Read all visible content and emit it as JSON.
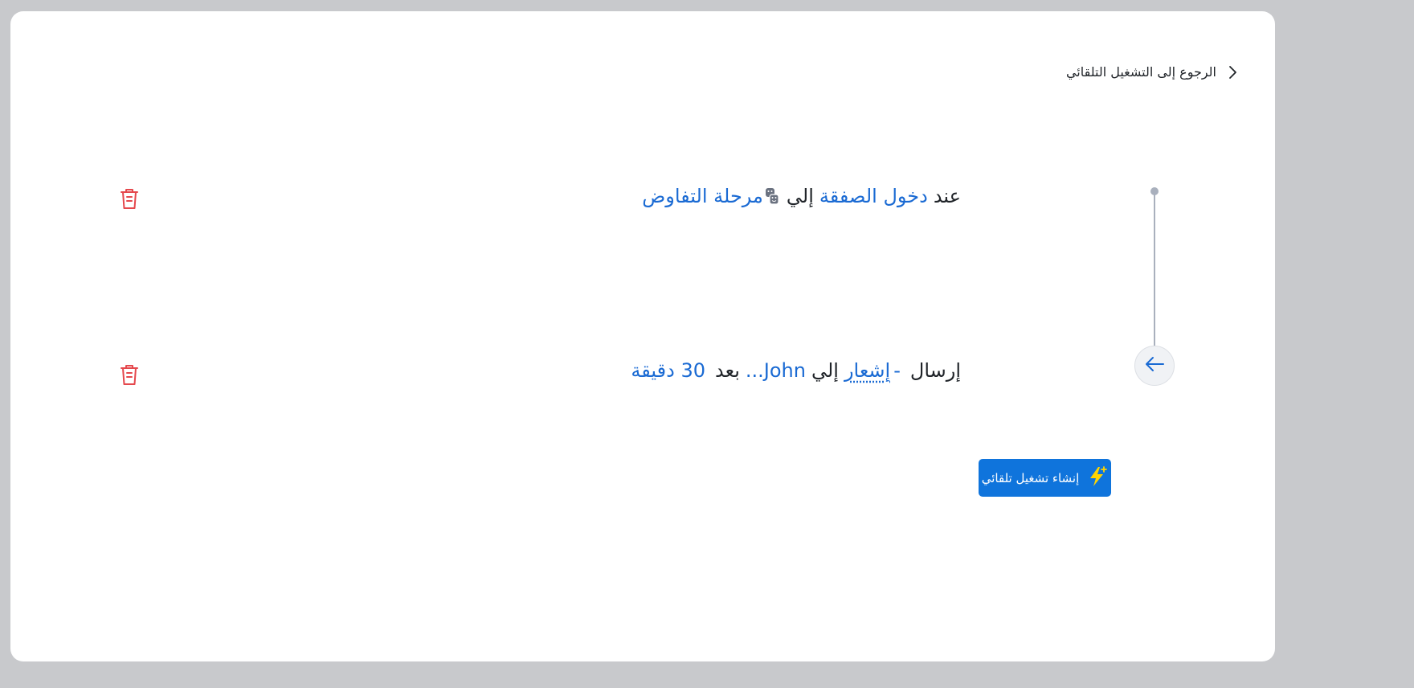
{
  "back": {
    "label": "الرجوع إلى التشغيل التلقائي"
  },
  "trigger": {
    "when": "عند",
    "event": "دخول الصفقة",
    "to": "إلي",
    "stage": "مرحلة التفاوض"
  },
  "action": {
    "send": "إرسال",
    "dash": "-",
    "type": "إشعار",
    "to": "إلي",
    "recipient": "John...",
    "after": "بعد",
    "delay": "30 دقيقة"
  },
  "create_button": {
    "label": "إنشاء تشغيل تلقائي"
  },
  "colors": {
    "accent": "#0f74dc",
    "link": "#1a6ad3",
    "danger": "#e5484d",
    "lightning": "#ffd400",
    "timeline": "#a9b0bd"
  },
  "icons": {
    "back": "chevron-right-icon",
    "stage": "theater-masks-icon",
    "action": "arrow-left-icon",
    "delete": "trash-icon",
    "create": "lightning-icon"
  }
}
